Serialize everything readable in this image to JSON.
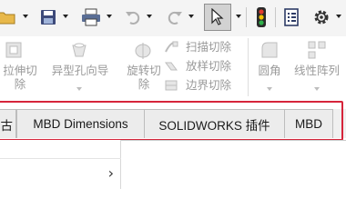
{
  "toolbar": {
    "icons": [
      "open-icon",
      "save-icon",
      "print-icon",
      "undo-icon",
      "redo-icon",
      "select-icon",
      "rebuild-icon",
      "file-properties-icon",
      "options-icon"
    ]
  },
  "ribbon": {
    "extrude_cut": "拉伸切\n除",
    "hole_wizard": "异型孔向导",
    "revolve_cut": "旋转切\n除",
    "swept_cut": "扫描切除",
    "lofted_cut": "放样切除",
    "boundary_cut": "边界切除",
    "fillet": "圆角",
    "linear_pattern": "线性阵列"
  },
  "tabs": {
    "partial": "古",
    "mbd_dimensions": "MBD Dimensions",
    "solidworks_addins": "SOLIDWORKS 插件",
    "mbd": "MBD"
  },
  "colors": {
    "highlight": "#d6243a",
    "disabled_text": "#9a9a9a"
  }
}
